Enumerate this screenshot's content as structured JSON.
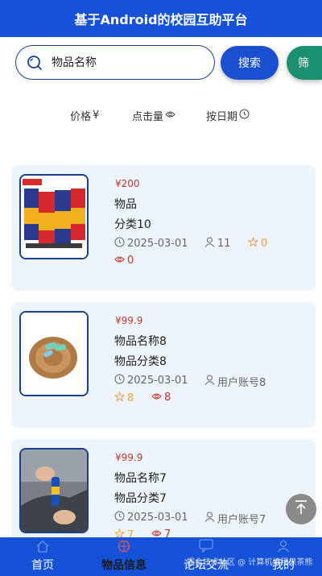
{
  "header": {
    "title": "基于Android的校园互助平台"
  },
  "search": {
    "placeholder": "物品名称",
    "button_label": "搜索",
    "filter_label": "筛"
  },
  "sort": {
    "price_label": "价格",
    "price_symbol": "¥",
    "clicks_label": "点击量",
    "date_label": "按日期"
  },
  "items": [
    {
      "price": "¥200",
      "name": "物品",
      "category": "分类10",
      "date": "2025-03-01",
      "user": "11",
      "stars": "0",
      "views": "0"
    },
    {
      "price": "¥99.9",
      "name": "物品名称8",
      "category": "物品分类8",
      "date": "2025-03-01",
      "user": "用户账号8",
      "stars": "8",
      "views": "8"
    },
    {
      "price": "¥99.9",
      "name": "物品名称7",
      "category": "物品分类7",
      "date": "2025-03-01",
      "user": "用户账号7",
      "stars": "7",
      "views": "7"
    }
  ],
  "tabbar": {
    "tabs": [
      {
        "label": "首页"
      },
      {
        "label": "物品信息"
      },
      {
        "label": "论坛交流"
      },
      {
        "label": "我的"
      }
    ]
  },
  "watermark": "掘金技术社区 @ 计算机编程果茶熊",
  "colors": {
    "primary": "#1552d8",
    "filter": "#1a9070",
    "price": "#c0392b",
    "star": "#e8a33d",
    "card_bg": "#eef4fb"
  }
}
